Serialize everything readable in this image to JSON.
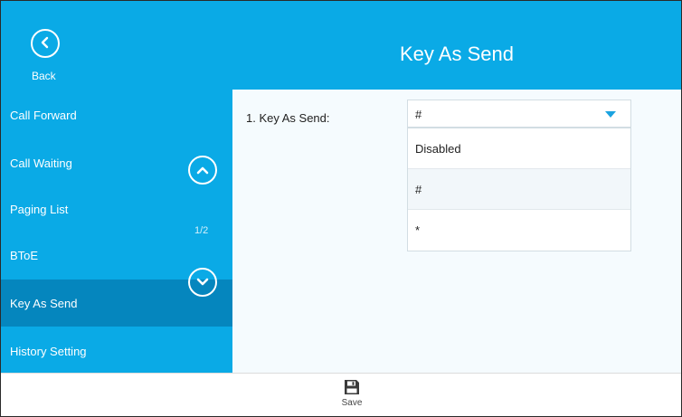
{
  "header": {
    "title": "Key As Send",
    "back_label": "Back"
  },
  "sidebar": {
    "items": [
      {
        "label": "Call Forward"
      },
      {
        "label": "Call Waiting"
      },
      {
        "label": "Paging List"
      },
      {
        "label": "BToE"
      },
      {
        "label": "Key As Send",
        "active": true
      },
      {
        "label": "History Setting"
      }
    ],
    "page_indicator": "1/2"
  },
  "form": {
    "field_label": "1. Key As Send:",
    "selected_value": "#",
    "options": [
      "Disabled",
      "#",
      "*"
    ]
  },
  "footer": {
    "save_label": "Save"
  },
  "colors": {
    "accent": "#0aaae6",
    "active_item": "#0586be"
  },
  "icons": {
    "back": "chevron-left-circle-icon",
    "scroll_up": "chevron-up-circle-icon",
    "scroll_down": "chevron-down-circle-icon",
    "dropdown": "triangle-down-icon",
    "save": "floppy-disk-icon"
  }
}
